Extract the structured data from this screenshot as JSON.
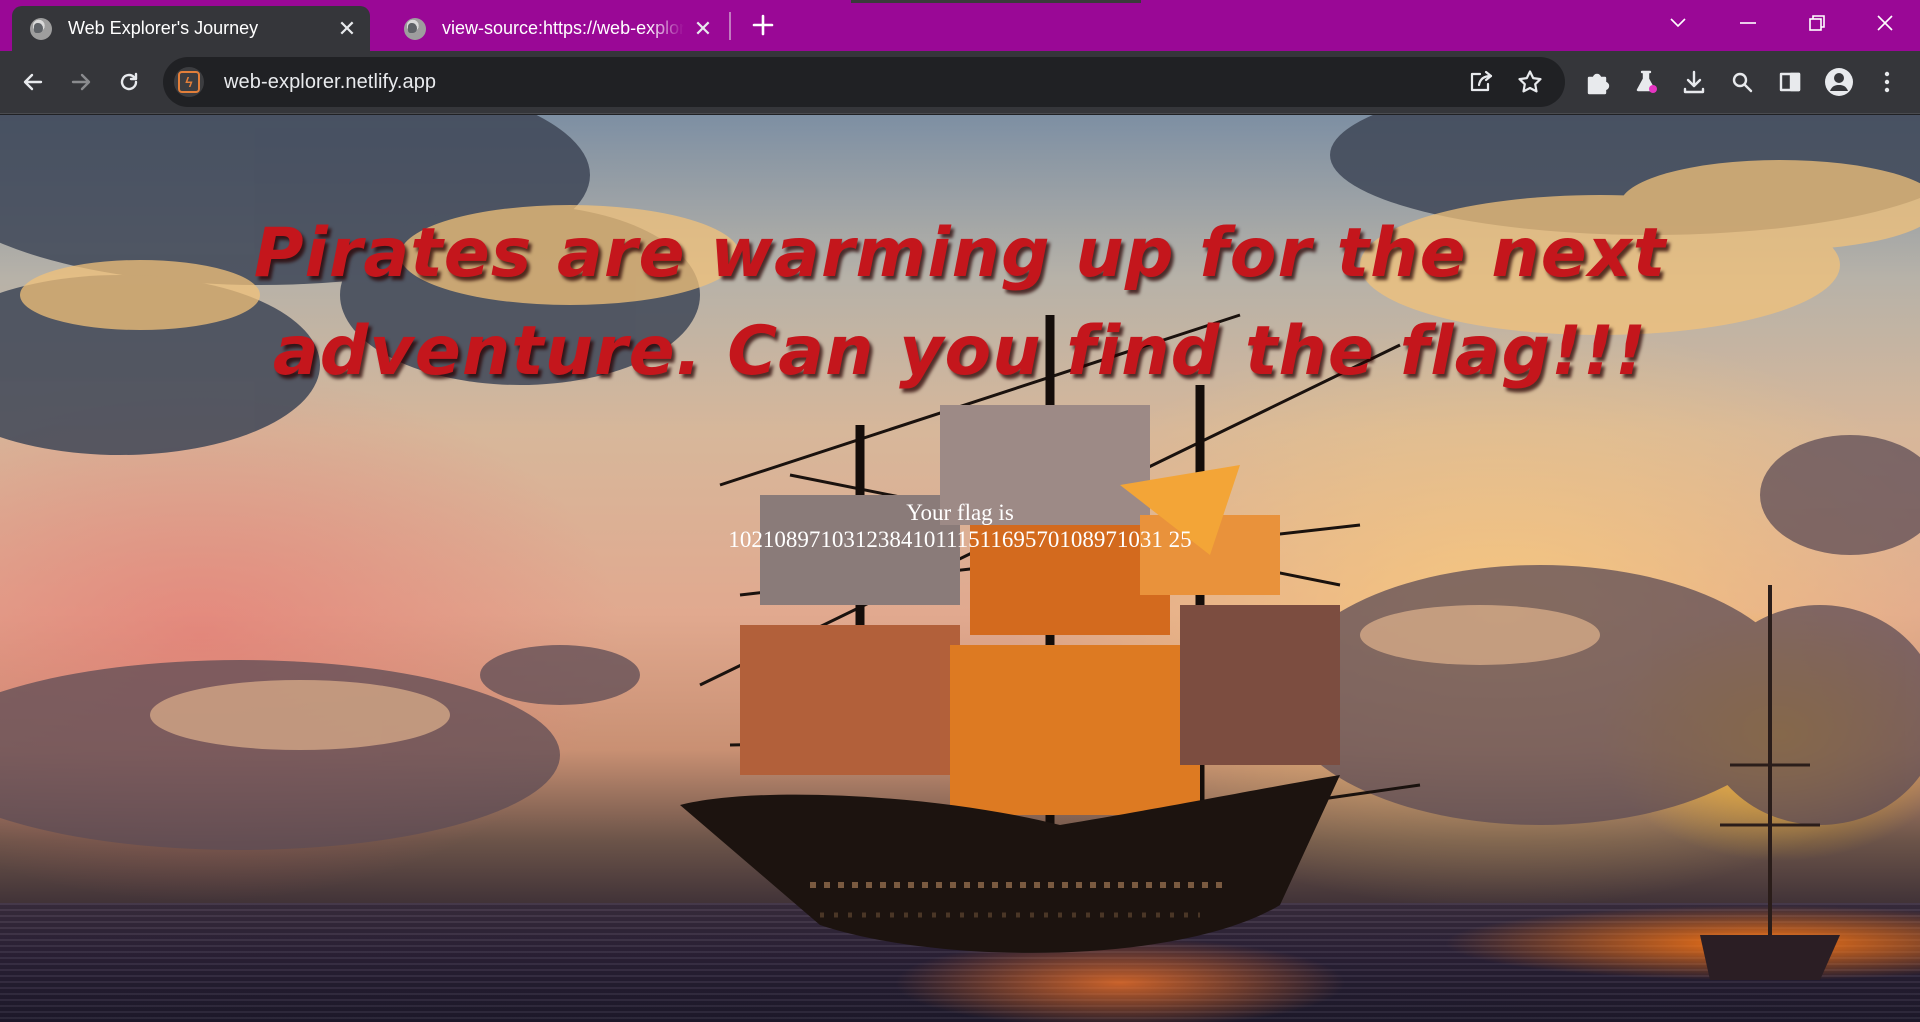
{
  "browser": {
    "tabs": [
      {
        "title": "Web Explorer's Journey",
        "active": true,
        "icon": "globe-icon"
      },
      {
        "title": "view-source:https://web-explorer.netlify.app/",
        "active": false,
        "icon": "globe-icon"
      }
    ],
    "new_tab_icon": "plus-icon",
    "window_controls": [
      "tab-search-icon",
      "minimize-icon",
      "restore-icon",
      "close-icon"
    ],
    "toolbar": {
      "back_icon": "arrow-left-icon",
      "forward_icon": "arrow-right-icon",
      "reload_icon": "reload-icon",
      "site_icon": "netlify-icon",
      "url": "web-explorer.netlify.app",
      "omnibox_actions": [
        "share-icon",
        "bookmark-star-icon"
      ],
      "extensions": [
        "extensions-puzzle-icon",
        "labs-flask-icon",
        "download-icon",
        "search-icon",
        "side-panel-icon",
        "profile-icon",
        "menu-dots-icon"
      ]
    },
    "accent_color": "#9a0896"
  },
  "page": {
    "headline": "Pirates are warming up for the next adventure. Can you find the flag!!!",
    "flag_label": "Your flag is",
    "flag_value": "10210897103123841011151169570108971031 25",
    "headline_color": "#c4161c",
    "background_image": "pirate-ship-at-sunset"
  }
}
